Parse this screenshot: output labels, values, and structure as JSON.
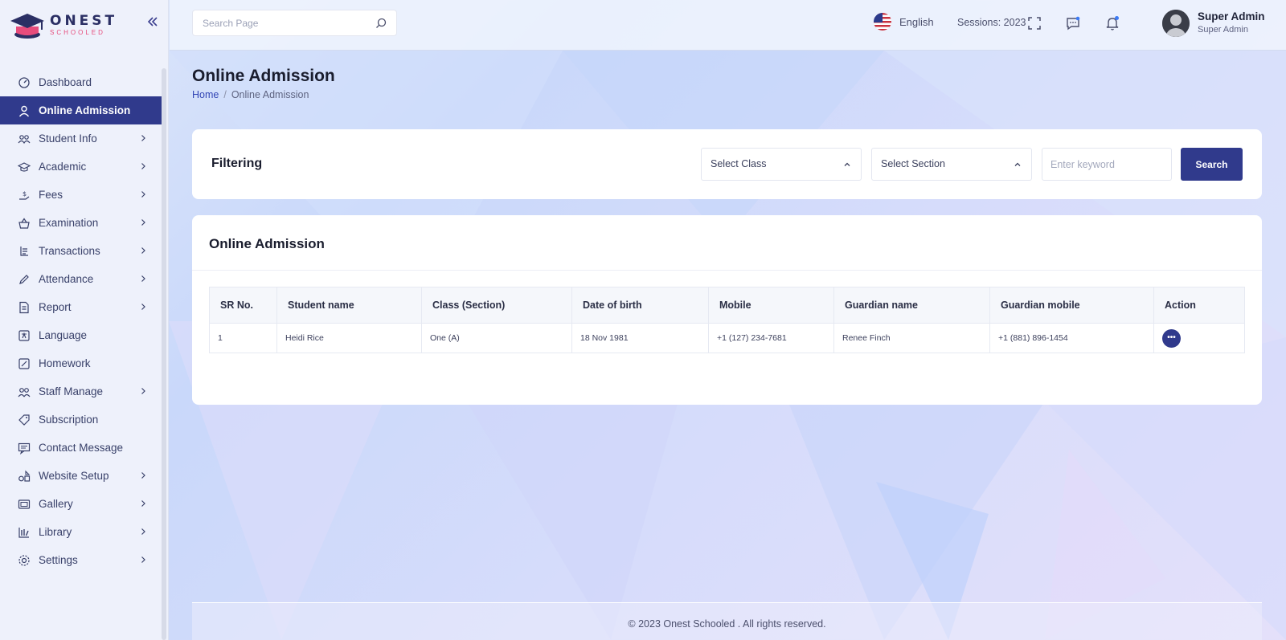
{
  "app": {
    "logo_main": "ONEST",
    "logo_sub": "SCHOOLED"
  },
  "sidebar": {
    "items": [
      {
        "label": "Dashboard",
        "icon": "dashboard-icon",
        "has_children": false,
        "active": false
      },
      {
        "label": "Online Admission",
        "icon": "user-icon",
        "has_children": false,
        "active": true
      },
      {
        "label": "Student Info",
        "icon": "students-icon",
        "has_children": true,
        "active": false
      },
      {
        "label": "Academic",
        "icon": "graduation-cap-icon",
        "has_children": true,
        "active": false
      },
      {
        "label": "Fees",
        "icon": "money-hand-icon",
        "has_children": true,
        "active": false
      },
      {
        "label": "Examination",
        "icon": "exam-basket-icon",
        "has_children": true,
        "active": false
      },
      {
        "label": "Transactions",
        "icon": "transactions-icon",
        "has_children": true,
        "active": false
      },
      {
        "label": "Attendance",
        "icon": "pen-icon",
        "has_children": true,
        "active": false
      },
      {
        "label": "Report",
        "icon": "report-icon",
        "has_children": true,
        "active": false
      },
      {
        "label": "Language",
        "icon": "language-icon",
        "has_children": false,
        "active": false
      },
      {
        "label": "Homework",
        "icon": "homework-icon",
        "has_children": false,
        "active": false
      },
      {
        "label": "Staff Manage",
        "icon": "staff-icon",
        "has_children": true,
        "active": false
      },
      {
        "label": "Subscription",
        "icon": "tag-icon",
        "has_children": false,
        "active": false
      },
      {
        "label": "Contact Message",
        "icon": "message-icon",
        "has_children": false,
        "active": false
      },
      {
        "label": "Website Setup",
        "icon": "website-icon",
        "has_children": true,
        "active": false
      },
      {
        "label": "Gallery",
        "icon": "gallery-icon",
        "has_children": true,
        "active": false
      },
      {
        "label": "Library",
        "icon": "library-icon",
        "has_children": true,
        "active": false
      },
      {
        "label": "Settings",
        "icon": "settings-icon",
        "has_children": true,
        "active": false
      }
    ]
  },
  "topbar": {
    "search_placeholder": "Search Page",
    "language": "English",
    "sessions": "Sessions: 2023",
    "user_name": "Super Admin",
    "user_role": "Super Admin"
  },
  "page": {
    "title": "Online Admission",
    "breadcrumb_home": "Home",
    "breadcrumb_separator": "/",
    "breadcrumb_current": "Online Admission"
  },
  "filter": {
    "title": "Filtering",
    "class_select": "Select Class",
    "section_select": "Select Section",
    "keyword_placeholder": "Enter keyword",
    "search_button": "Search"
  },
  "table": {
    "title": "Online Admission",
    "columns": [
      "SR No.",
      "Student name",
      "Class (Section)",
      "Date of birth",
      "Mobile",
      "Guardian name",
      "Guardian mobile",
      "Action"
    ],
    "rows": [
      {
        "sr": "1",
        "student": "Heidi Rice",
        "class": "One (A)",
        "dob": "18 Nov 1981",
        "mobile": "+1 (127) 234-7681",
        "guardian": "Renee Finch",
        "guardian_mobile": "+1 (881) 896-1454",
        "action": "•••"
      }
    ]
  },
  "footer": {
    "text": "© 2023 Onest Schooled . All rights reserved."
  },
  "colors": {
    "primary": "#303a8c",
    "brand_pink": "#e74c7c",
    "notification_dot": "#3d7bf5"
  }
}
